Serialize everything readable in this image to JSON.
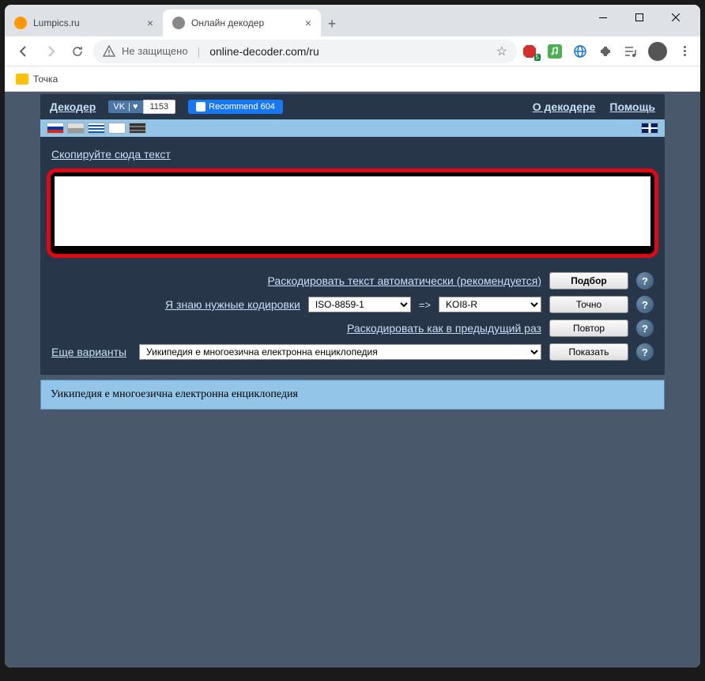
{
  "browser": {
    "tabs": [
      {
        "title": "Lumpics.ru",
        "favicon_color": "#ff9800"
      },
      {
        "title": "Онлайн декодер",
        "favicon_color": "#888"
      }
    ],
    "address": {
      "security_text": "Не защищено",
      "url": "online-decoder.com/ru"
    },
    "bookmarks": [
      {
        "label": "Точка"
      }
    ],
    "ext_badge": "5"
  },
  "app": {
    "title": "Декодер",
    "vk_label": "VK",
    "vk_count": "1153",
    "fb_label": "Recommend 604",
    "links": {
      "about": "О декодере",
      "help": "Помощь"
    },
    "paste_label": "Скопируйте сюда текст",
    "textarea_value": "",
    "rows": {
      "auto": {
        "label": "Раскодировать текст автоматически (рекомендуется)",
        "button": "Подбор"
      },
      "known": {
        "label": "Я знаю нужные кодировки",
        "from_encoding": "ISO-8859-1",
        "to_encoding": "KOI8-R",
        "button": "Точно"
      },
      "repeat": {
        "label": "Раскодировать как в предыдущий раз",
        "button": "Повтор"
      },
      "more": {
        "label": "Еще варианты",
        "option": "Уикипедия е многоезична електронна енциклопедия",
        "button": "Показать"
      }
    },
    "result_text": "Уикипедия е многоезична електронна енциклопедия",
    "help_tooltip": "?"
  }
}
